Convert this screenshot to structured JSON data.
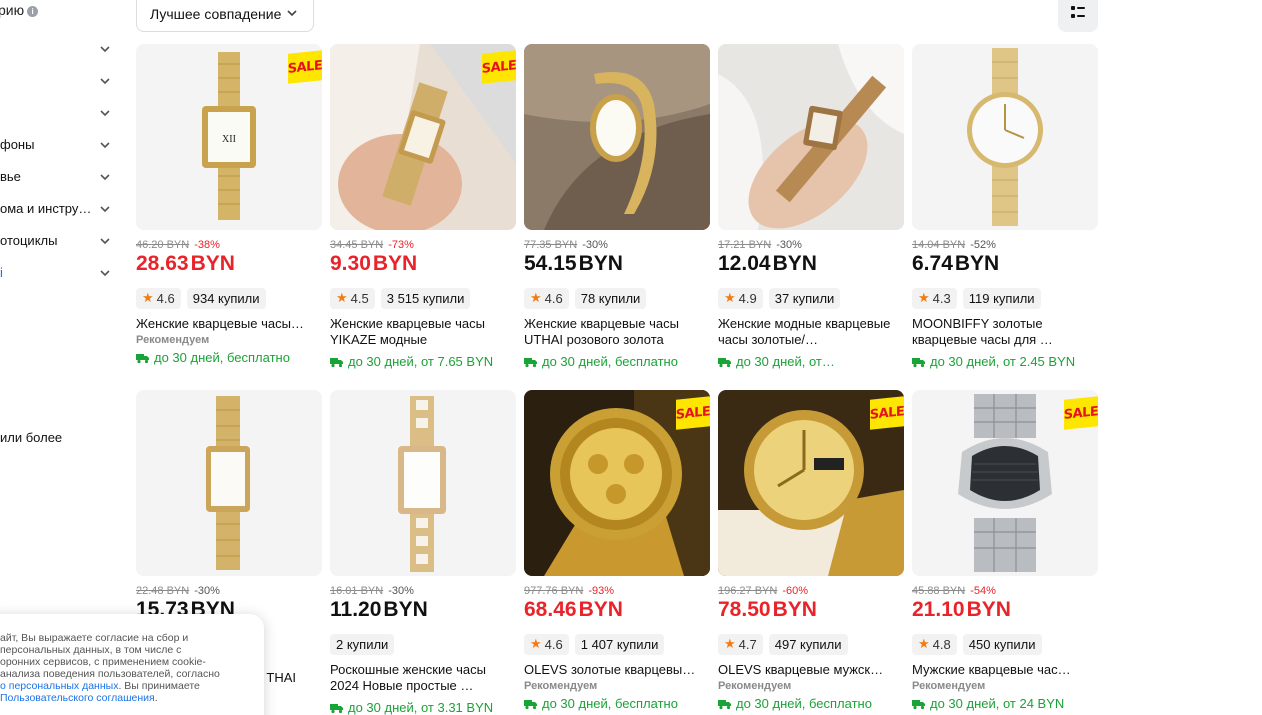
{
  "sidebar": {
    "top_text": "рию",
    "items": [
      {
        "label": ""
      },
      {
        "label": ""
      },
      {
        "label": ""
      },
      {
        "label": "фоны"
      },
      {
        "label": "вье"
      },
      {
        "label": "ома и инстру…"
      },
      {
        "label": "отоциклы"
      },
      {
        "label": "і"
      }
    ],
    "more_text": "или более"
  },
  "sort": {
    "label": "Лучшее совпадение"
  },
  "sale_label": "SALE",
  "recommended_label": "Рекомендуем",
  "products": [
    {
      "old_price": "46.20 BYN",
      "discount": "-38%",
      "price": "28.63",
      "currency": "BYN",
      "rating": "4.6",
      "bought": "934 купили",
      "title": "Женские кварцевые часы…",
      "recommended": true,
      "shipping": "до 30 дней, бесплатно",
      "sale": true
    },
    {
      "old_price": "34.45 BYN",
      "discount": "-73%",
      "price": "9.30",
      "currency": "BYN",
      "rating": "4.5",
      "bought": "3 515 купили",
      "title": "Женские кварцевые часы YIKAZE  модные",
      "recommended": false,
      "shipping": "до 30 дней, от 7.65 BYN",
      "sale": true
    },
    {
      "old_price": "77.35 BYN",
      "discount": "-30%",
      "price": "54.15",
      "currency": "BYN",
      "rating": "4.6",
      "bought": "78 купили",
      "title": "Женские кварцевые часы UTHAI розового золота",
      "recommended": false,
      "shipping": "до 30 дней, бесплатно",
      "sale": false
    },
    {
      "old_price": "17.21 BYN",
      "discount": "-30%",
      "price": "12.04",
      "currency": "BYN",
      "rating": "4.9",
      "bought": "37 купили",
      "title": "Женские модные кварцевые часы золотые/…",
      "recommended": false,
      "shipping": "до 30 дней, от…",
      "sale": false
    },
    {
      "old_price": "14.04 BYN",
      "discount": "-52%",
      "price": "6.74",
      "currency": "BYN",
      "rating": "4.3",
      "bought": "119 купили",
      "title": "MOONBIFFY золотые кварцевые часы для …",
      "recommended": false,
      "shipping": "до 30 дней, от 2.45 BYN",
      "sale": false
    },
    {
      "old_price": "22.48 BYN",
      "discount": "-30%",
      "price": "15.73",
      "currency": "BYN",
      "rating": "",
      "bought": "",
      "title": "THAI",
      "recommended": false,
      "shipping": "",
      "sale": false
    },
    {
      "old_price": "16.01 BYN",
      "discount": "-30%",
      "price": "11.20",
      "currency": "BYN",
      "rating": "",
      "bought": "2 купили",
      "title": "Роскошные женские часы 2024 Новые простые …",
      "recommended": false,
      "shipping": "до 30 дней, от 3.31 BYN",
      "sale": false
    },
    {
      "old_price": "977.76 BYN",
      "discount": "-93%",
      "price": "68.46",
      "currency": "BYN",
      "rating": "4.6",
      "bought": "1 407 купили",
      "title": "OLEVS золотые кварцевы…",
      "recommended": true,
      "shipping": "до 30 дней, бесплатно",
      "sale": true
    },
    {
      "old_price": "196.27 BYN",
      "discount": "-60%",
      "price": "78.50",
      "currency": "BYN",
      "rating": "4.7",
      "bought": "497 купили",
      "title": "OLEVS кварцевые мужск…",
      "recommended": true,
      "shipping": "до 30 дней, бесплатно",
      "sale": true
    },
    {
      "old_price": "45.88 BYN",
      "discount": "-54%",
      "price": "21.10",
      "currency": "BYN",
      "rating": "4.8",
      "bought": "450 купили",
      "title": "Мужские кварцевые час…",
      "recommended": true,
      "shipping": "до 30 дней, от 24 BYN",
      "sale": true
    }
  ],
  "cookie": {
    "line1": "айт, Вы выражаете согласие на сбор и",
    "line2": "персональных данных, в том числе с",
    "line3": "оронних сервисов, с применением cookie-",
    "line4": "анализа поведения пользователей, согласно",
    "link1": "о персональных данных",
    "line5_rest": ". Вы принимаете",
    "link2": "Пользовательского соглашения",
    "line6_rest": "."
  }
}
